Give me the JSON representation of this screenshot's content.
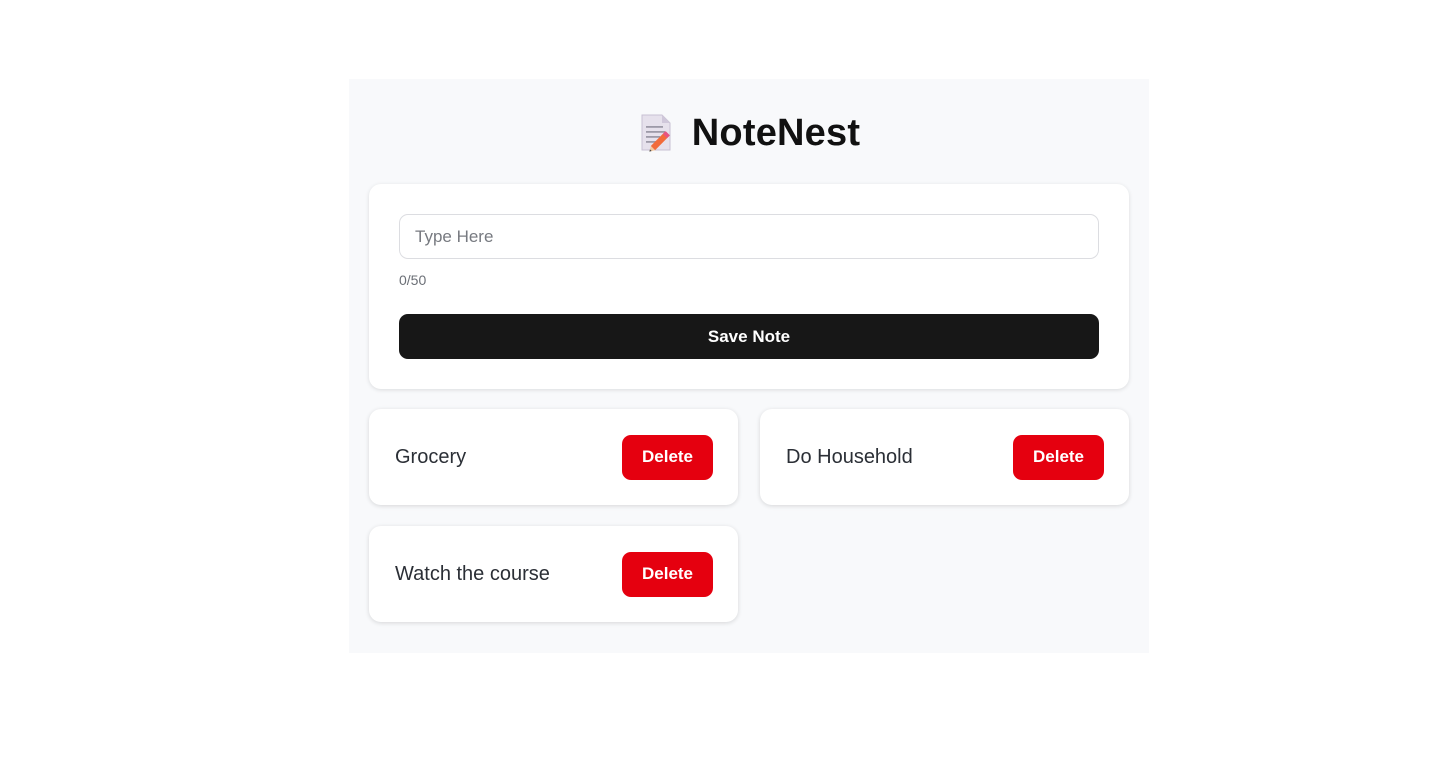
{
  "app": {
    "icon": "memo-pencil-icon",
    "title": "NoteNest"
  },
  "composer": {
    "input_value": "",
    "input_placeholder": "Type Here",
    "counter": "0/50",
    "save_label": "Save Note"
  },
  "notes": [
    {
      "text": "Grocery",
      "delete_label": "Delete"
    },
    {
      "text": "Do Household",
      "delete_label": "Delete"
    },
    {
      "text": "Watch the course",
      "delete_label": "Delete"
    }
  ],
  "colors": {
    "save_button": "#171717",
    "delete_button": "#e5000f",
    "panel_background": "#f8f9fb"
  }
}
